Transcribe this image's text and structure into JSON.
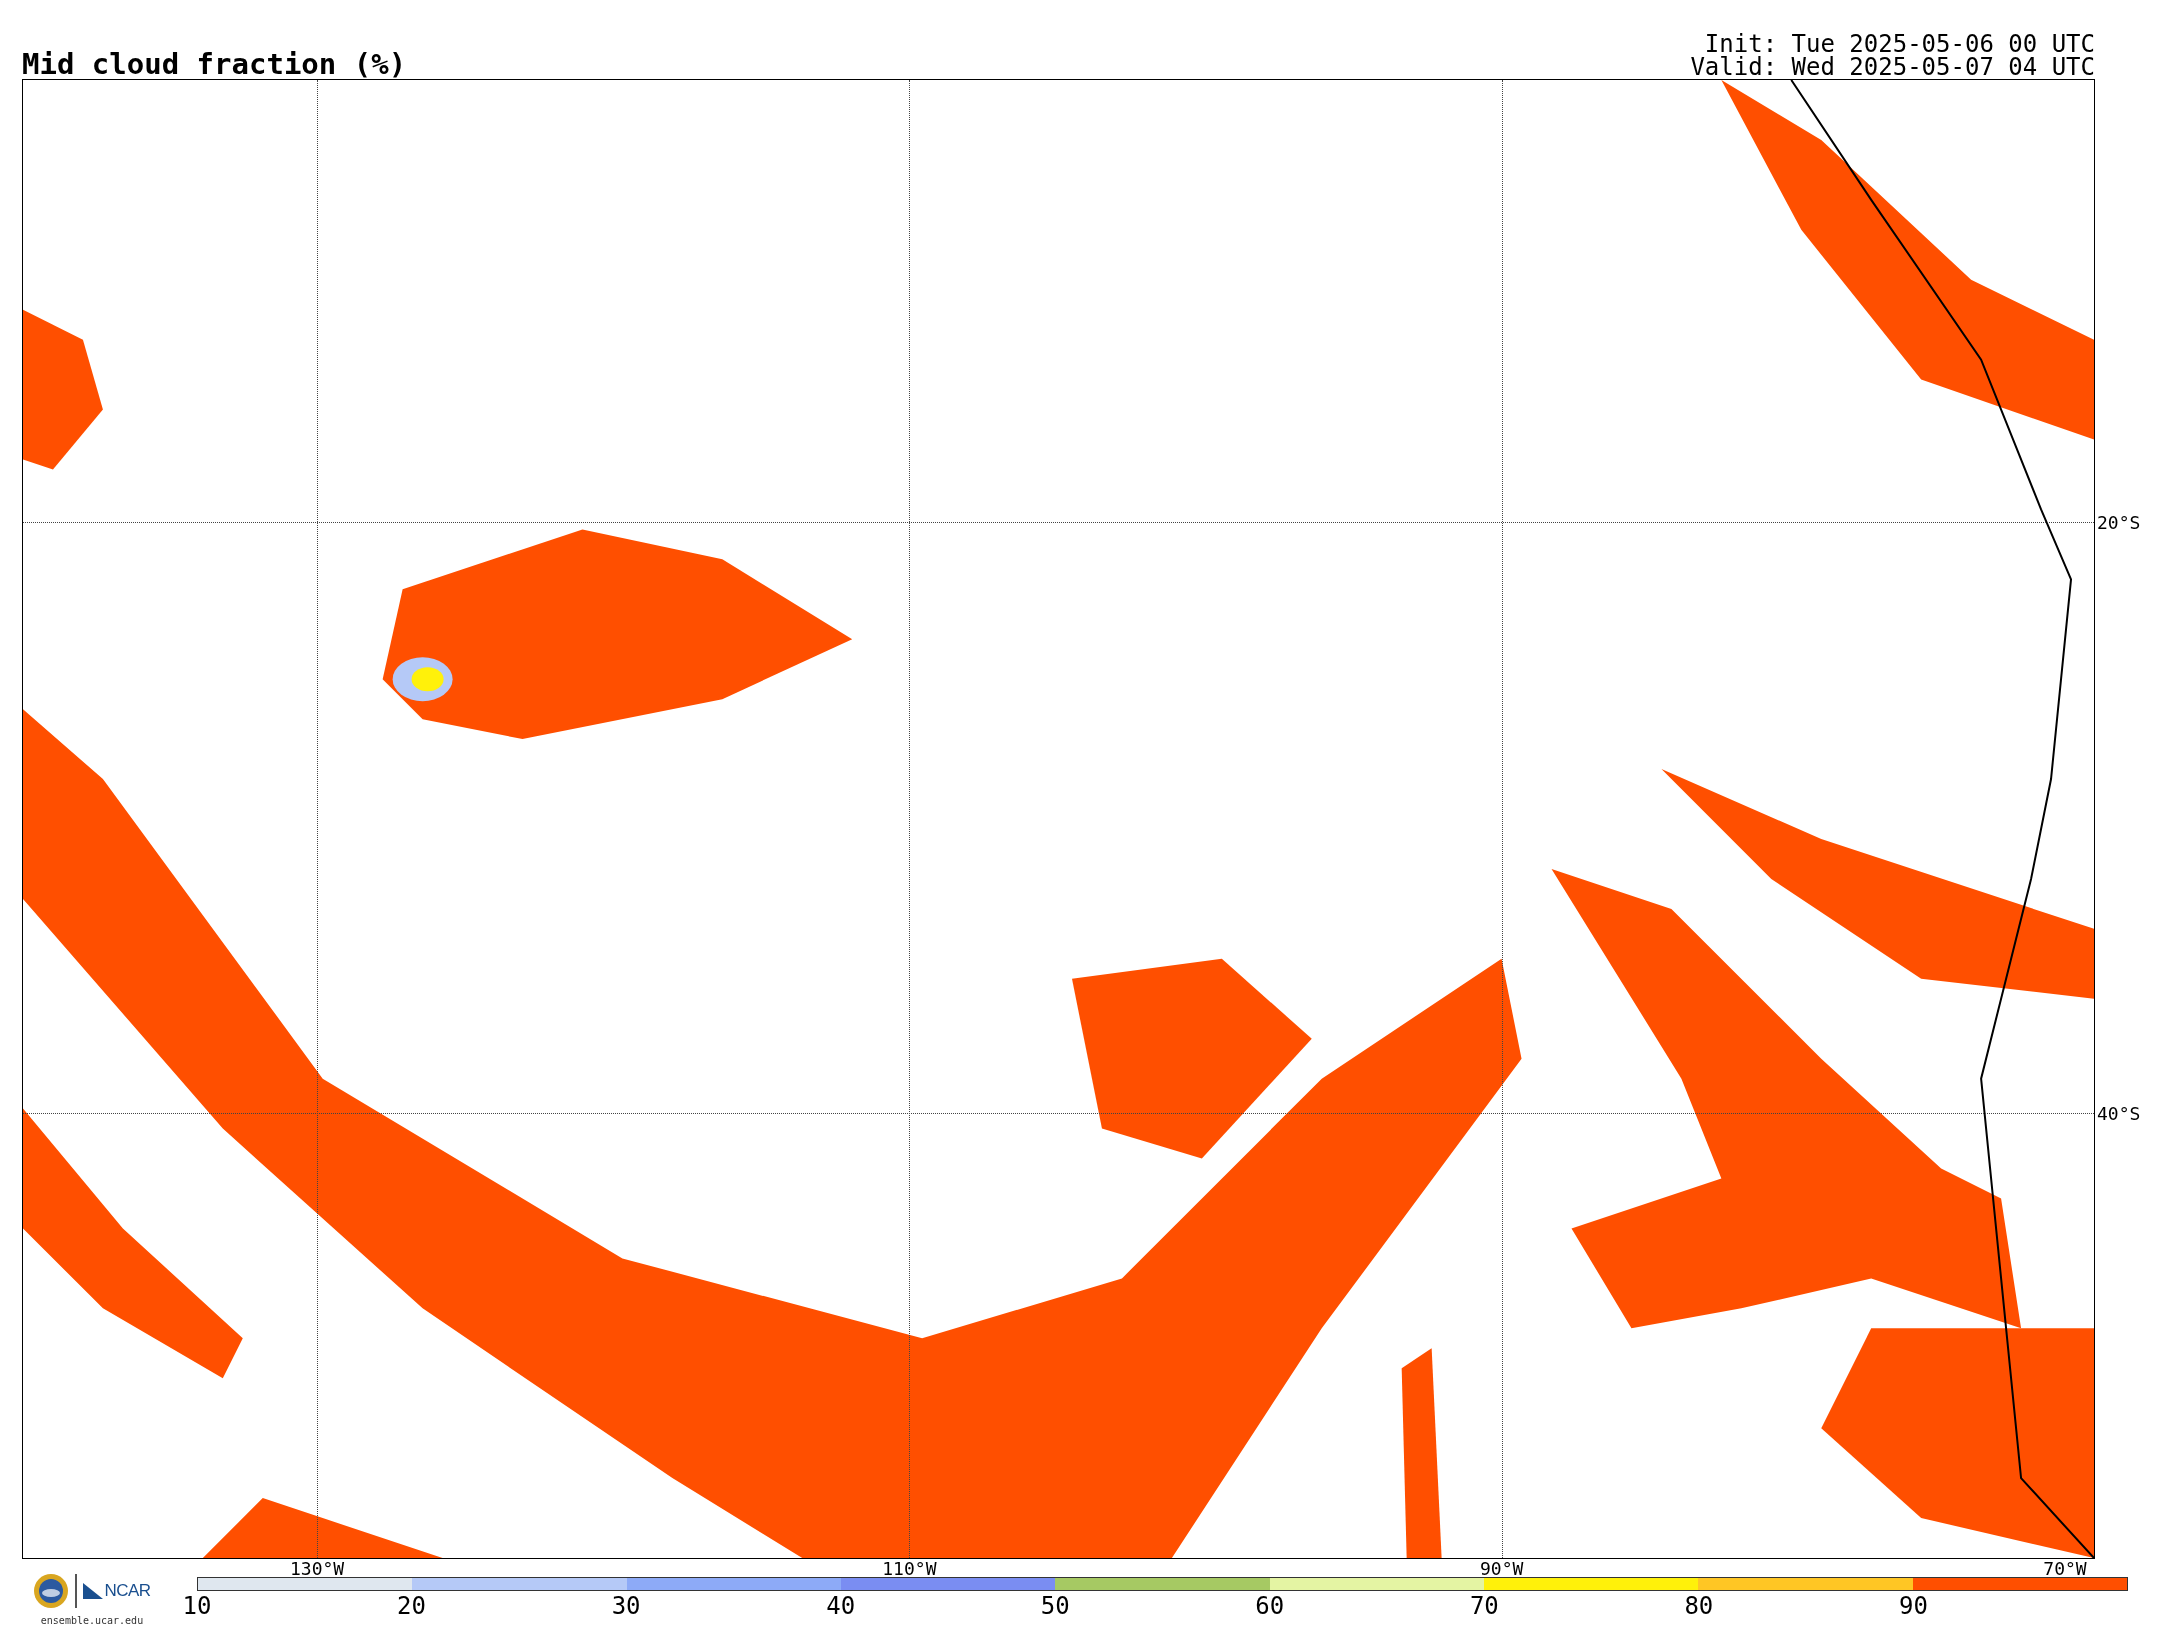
{
  "title": "Mid cloud fraction (%)",
  "run_info": [
    "Init: Tue 2025-05-06 00 UTC",
    "Valid: Wed 2025-05-07 04 UTC"
  ],
  "map": {
    "lat_labels": [
      "20°S",
      "40°S"
    ],
    "lon_labels": [
      "130°W",
      "110°W",
      "90°W",
      "70°W"
    ]
  },
  "logo": {
    "name": "NCAR",
    "url": "ensemble.ucar.edu"
  },
  "colorbar": {
    "ticks": [
      "10",
      "20",
      "30",
      "40",
      "50",
      "60",
      "70",
      "80",
      "90"
    ],
    "bins": [
      {
        "color": "#dfe7ef"
      },
      {
        "color": "#b5c9f7"
      },
      {
        "color": "#8daaf7"
      },
      {
        "color": "#7a8df2"
      },
      {
        "color": "#a6c963"
      },
      {
        "color": "#e4f4a3"
      },
      {
        "color": "#fff10a"
      },
      {
        "color": "#ffc624"
      },
      {
        "color": "#ff4f00"
      }
    ]
  }
}
